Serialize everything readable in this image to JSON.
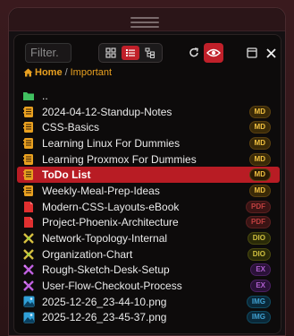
{
  "toolbar": {
    "filter_placeholder": "Filter.",
    "view_modes": [
      "grid",
      "list",
      "tree"
    ],
    "active_view": "list"
  },
  "breadcrumb": {
    "home": "Home",
    "separator": "/",
    "current": "Important"
  },
  "files": [
    {
      "name": "..",
      "type": "parent",
      "badge": ""
    },
    {
      "name": "2024-04-12-Standup-Notes",
      "type": "md",
      "badge": "MD"
    },
    {
      "name": "CSS-Basics",
      "type": "md",
      "badge": "MD"
    },
    {
      "name": "Learning Linux For Dummies",
      "type": "md",
      "badge": "MD"
    },
    {
      "name": "Learning Proxmox For Dummies",
      "type": "md",
      "badge": "MD"
    },
    {
      "name": "ToDo List",
      "type": "md",
      "badge": "MD",
      "selected": true
    },
    {
      "name": "Weekly-Meal-Prep-Ideas",
      "type": "md",
      "badge": "MD"
    },
    {
      "name": "Modern-CSS-Layouts-eBook",
      "type": "pdf",
      "badge": "PDF"
    },
    {
      "name": "Project-Phoenix-Architecture",
      "type": "pdf",
      "badge": "PDF"
    },
    {
      "name": "Network-Topology-Internal",
      "type": "dio",
      "badge": "DIO"
    },
    {
      "name": "Organization-Chart",
      "type": "dio",
      "badge": "DIO"
    },
    {
      "name": "Rough-Sketch-Desk-Setup",
      "type": "ex",
      "badge": "EX"
    },
    {
      "name": "User-Flow-Checkout-Process",
      "type": "ex",
      "badge": "EX"
    },
    {
      "name": "2025-12-26_23-44-10.png",
      "type": "img",
      "badge": "IMG"
    },
    {
      "name": "2025-12-26_23-45-37.png",
      "type": "img",
      "badge": "IMG"
    }
  ],
  "colors": {
    "accent": "#c0202a",
    "breadcrumb": "#e8a020",
    "md": "#f0c040",
    "pdf": "#c04040",
    "dio": "#d0c040",
    "ex": "#b060d0",
    "img": "#40a0d0"
  }
}
